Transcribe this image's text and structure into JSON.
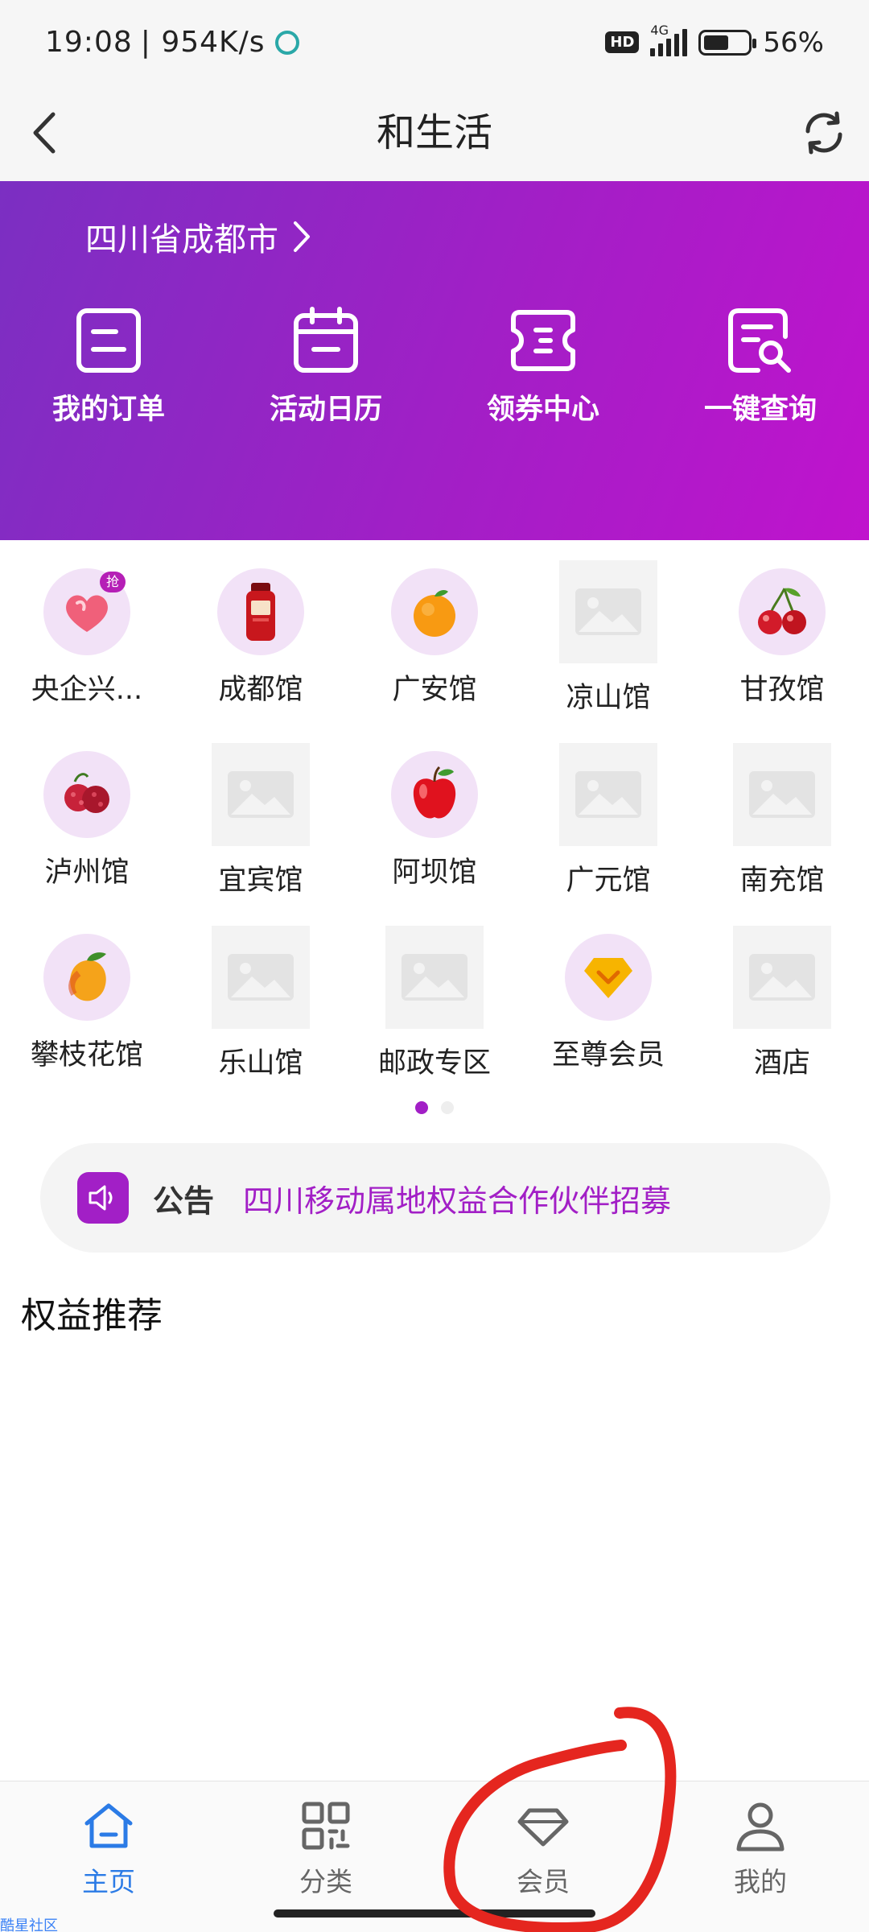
{
  "status_bar": {
    "time": "19:08",
    "speed": "| 954K/s",
    "hd": "HD",
    "network": "4G",
    "battery": "56%",
    "battery_level": 0.56
  },
  "header": {
    "title": "和生活",
    "back_icon": "chevron-left-icon",
    "refresh_icon": "refresh-icon"
  },
  "hero": {
    "location": "四川省成都市",
    "accent_start": "#7b2fc2",
    "accent_end": "#c013cd",
    "actions": [
      {
        "label": "我的订单",
        "icon": "order-icon"
      },
      {
        "label": "活动日历",
        "icon": "calendar-icon"
      },
      {
        "label": "领券中心",
        "icon": "coupon-icon"
      },
      {
        "label": "一键查询",
        "icon": "search-doc-icon"
      }
    ]
  },
  "categories": [
    {
      "label": "央企兴...",
      "icon": "heart-gift-icon",
      "badge": "抢"
    },
    {
      "label": "成都馆",
      "icon": "jar-icon"
    },
    {
      "label": "广安馆",
      "icon": "orange-icon"
    },
    {
      "label": "凉山馆",
      "icon": "image-placeholder-icon"
    },
    {
      "label": "甘孜馆",
      "icon": "cherry-icon"
    },
    {
      "label": "泸州馆",
      "icon": "lychee-icon"
    },
    {
      "label": "宜宾馆",
      "icon": "image-placeholder-icon"
    },
    {
      "label": "阿坝馆",
      "icon": "apple-icon"
    },
    {
      "label": "广元馆",
      "icon": "image-placeholder-icon"
    },
    {
      "label": "南充馆",
      "icon": "image-placeholder-icon"
    },
    {
      "label": "攀枝花馆",
      "icon": "mango-icon"
    },
    {
      "label": "乐山馆",
      "icon": "image-placeholder-icon"
    },
    {
      "label": "邮政专区",
      "icon": "image-placeholder-icon"
    },
    {
      "label": "至尊会员",
      "icon": "diamond-badge-icon"
    },
    {
      "label": "酒店",
      "icon": "image-placeholder-icon"
    }
  ],
  "pager": {
    "pages": 2,
    "current": 1
  },
  "notice": {
    "label": "公告",
    "text": "四川移动属地权益合作伙伴招募"
  },
  "section": {
    "title": "权益推荐"
  },
  "bottom_nav": [
    {
      "label": "主页",
      "icon": "home-icon",
      "active": true
    },
    {
      "label": "分类",
      "icon": "grid-icon",
      "active": false
    },
    {
      "label": "会员",
      "icon": "diamond-icon",
      "active": false
    },
    {
      "label": "我的",
      "icon": "user-icon",
      "active": false
    }
  ],
  "watermark": "酷星社区",
  "colors": {
    "accent": "#a21fc6",
    "nav_active": "#2b7be6",
    "annotation": "#e5261f"
  }
}
